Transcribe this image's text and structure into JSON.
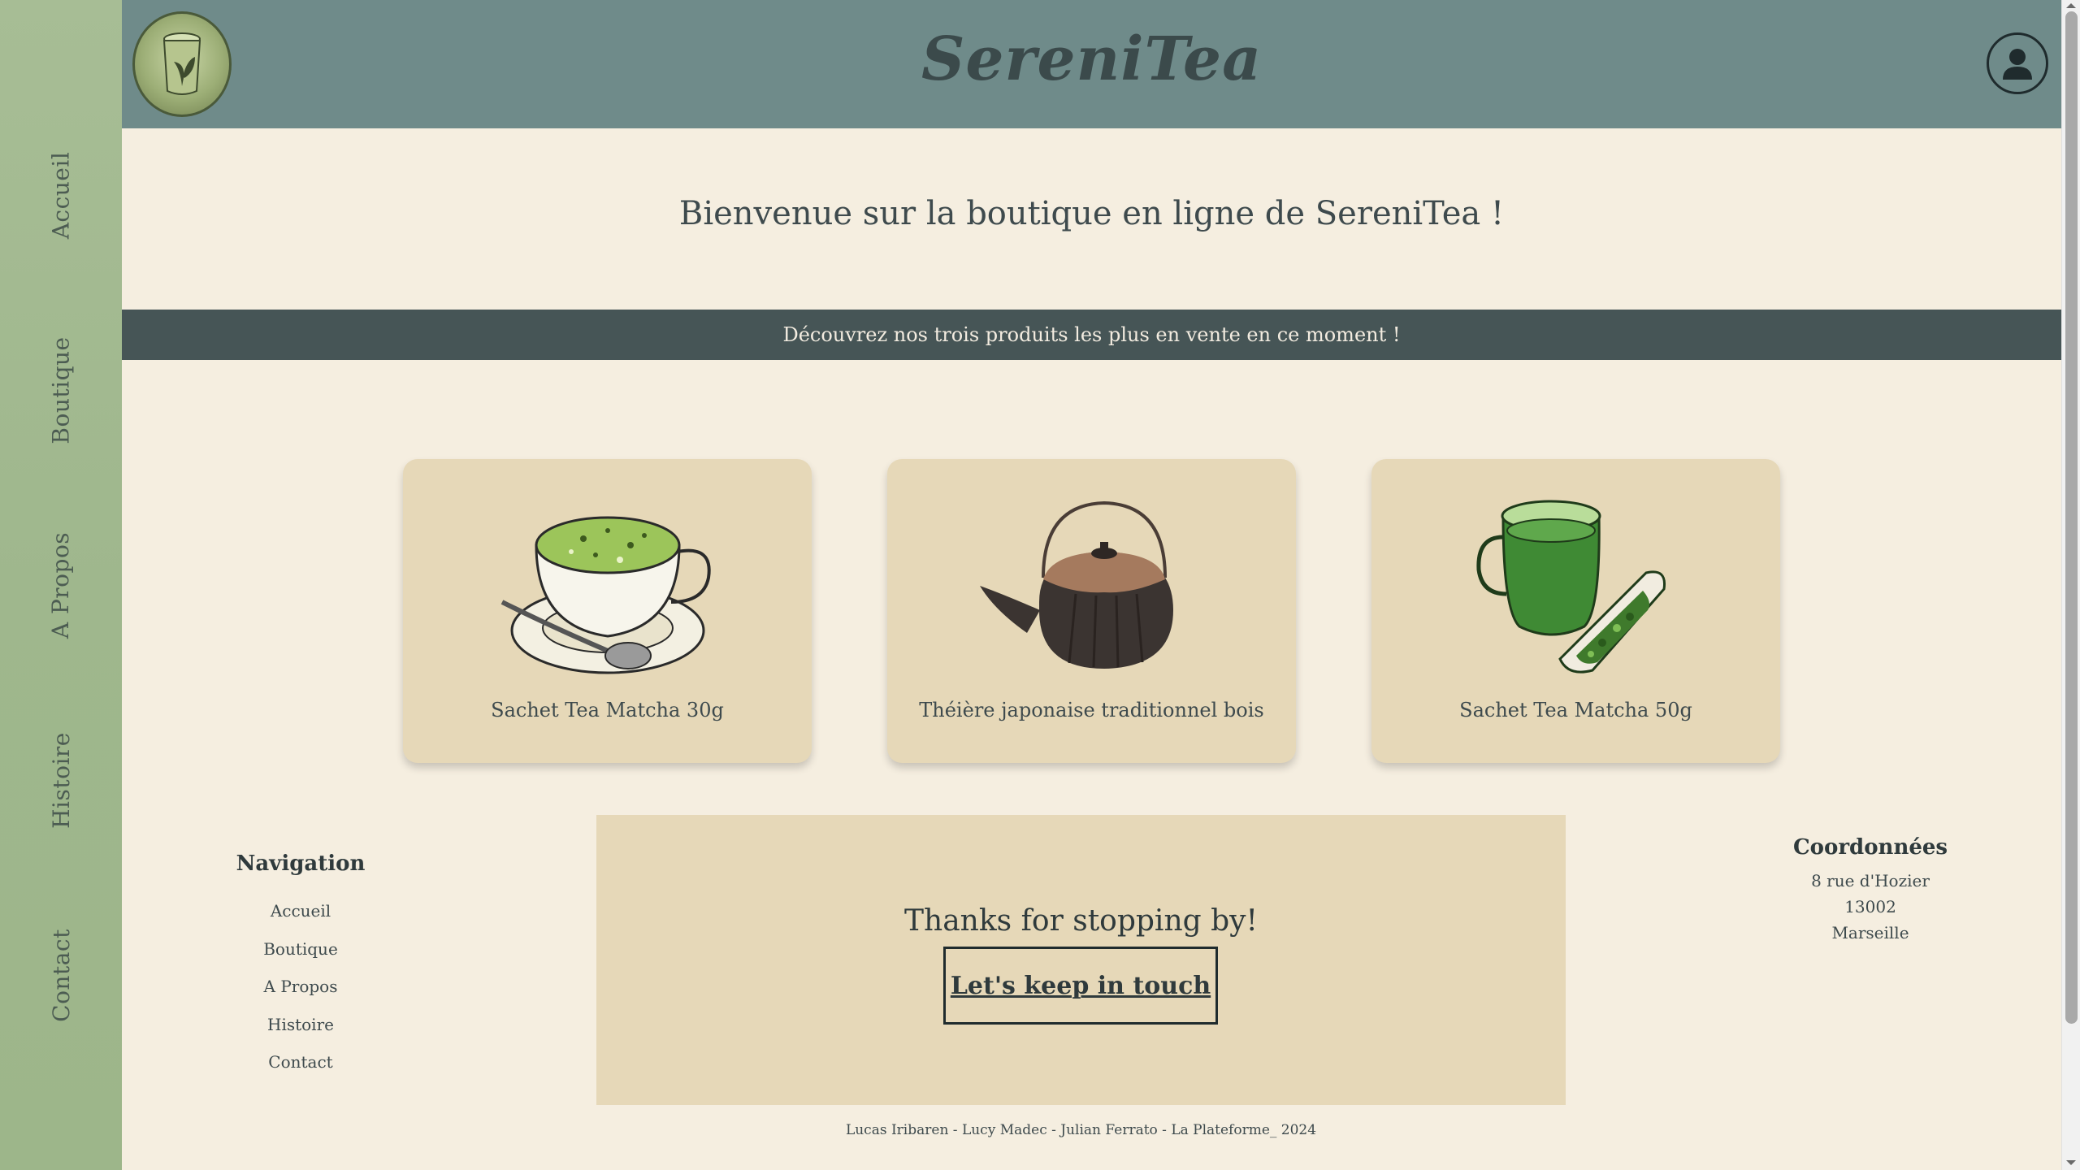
{
  "sidebar": {
    "items": [
      {
        "label": "Accueil"
      },
      {
        "label": "Boutique"
      },
      {
        "label": "A Propos"
      },
      {
        "label": "Histoire"
      },
      {
        "label": "Contact"
      }
    ]
  },
  "header": {
    "brand": "SereniTea",
    "logo_icon": "tea-cup-leaf-icon",
    "account_icon": "user-account-icon"
  },
  "hero": {
    "welcome": "Bienvenue sur la boutique en ligne de SereniTea !",
    "banner": "Découvrez nos trois produits les plus en vente en ce moment !"
  },
  "products": [
    {
      "name": "Sachet Tea Matcha 30g",
      "icon": "matcha-cup-icon"
    },
    {
      "name": "Théière japonaise traditionnel bois",
      "icon": "teapot-icon"
    },
    {
      "name": "Sachet Tea Matcha 50g",
      "icon": "green-tea-glass-icon"
    }
  ],
  "footer": {
    "navigation": {
      "title": "Navigation",
      "links": [
        "Accueil",
        "Boutique",
        "A Propos",
        "Histoire",
        "Contact"
      ]
    },
    "touch": {
      "title": "Thanks for stopping by!",
      "button": "Let's keep in touch"
    },
    "coordinates": {
      "title": "Coordonnées",
      "lines": [
        "8 rue d'Hozier",
        "13002",
        "Marseille"
      ]
    },
    "credits": "Lucas Iribaren - Lucy Madec - Julian Ferrato - La Plateforme_ 2024"
  },
  "colors": {
    "sidebar": "#a7bd95",
    "header": "#6f8b8a",
    "page_bg": "#f5eee0",
    "banner": "#465556",
    "card": "#e6d8b8"
  }
}
